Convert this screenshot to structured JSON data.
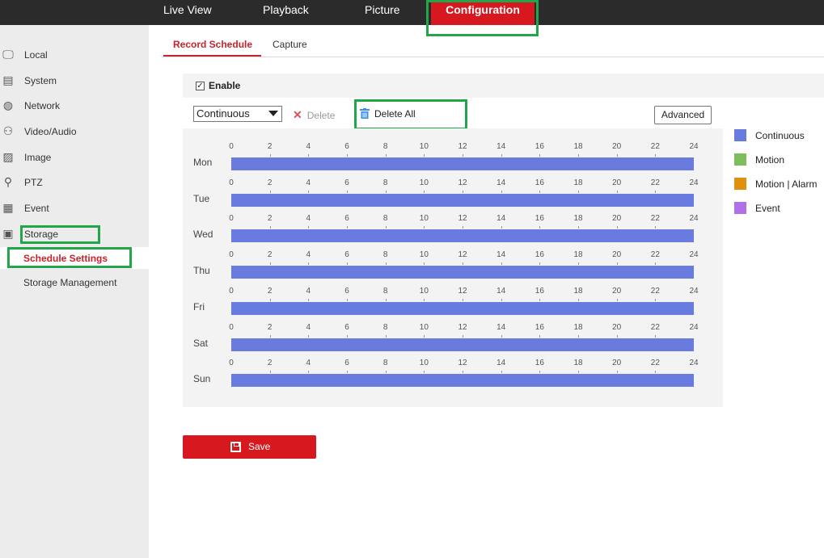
{
  "nav": {
    "items": [
      "Live View",
      "Playback",
      "Picture"
    ],
    "active": "Configuration"
  },
  "sidebar": {
    "items": [
      {
        "label": "Local",
        "icon": "monitor-icon"
      },
      {
        "label": "System",
        "icon": "system-icon"
      },
      {
        "label": "Network",
        "icon": "globe-icon"
      },
      {
        "label": "Video/Audio",
        "icon": "video-audio-icon"
      },
      {
        "label": "Image",
        "icon": "image-icon"
      },
      {
        "label": "PTZ",
        "icon": "ptz-icon"
      },
      {
        "label": "Event",
        "icon": "calendar-icon"
      },
      {
        "label": "Storage",
        "icon": "storage-icon"
      }
    ],
    "sub_items": [
      "Schedule Settings",
      "Storage Management"
    ]
  },
  "tabs": [
    "Record Schedule",
    "Capture"
  ],
  "enable": {
    "label": "Enable",
    "checked": true
  },
  "toolbar": {
    "record_type": "Continuous",
    "delete_label": "Delete",
    "delete_all_label": "Delete All",
    "advanced_label": "Advanced"
  },
  "schedule": {
    "hour_ticks": [
      "0",
      "2",
      "4",
      "6",
      "8",
      "10",
      "12",
      "14",
      "16",
      "18",
      "20",
      "22",
      "24"
    ],
    "days": [
      {
        "day": "Mon",
        "type": "Continuous",
        "start": 0,
        "end": 24
      },
      {
        "day": "Tue",
        "type": "Continuous",
        "start": 0,
        "end": 24
      },
      {
        "day": "Wed",
        "type": "Continuous",
        "start": 0,
        "end": 24
      },
      {
        "day": "Thu",
        "type": "Continuous",
        "start": 0,
        "end": 24
      },
      {
        "day": "Fri",
        "type": "Continuous",
        "start": 0,
        "end": 24
      },
      {
        "day": "Sat",
        "type": "Continuous",
        "start": 0,
        "end": 24
      },
      {
        "day": "Sun",
        "type": "Continuous",
        "start": 0,
        "end": 24
      }
    ]
  },
  "legend": [
    {
      "label": "Continuous",
      "color": "#6a7be0"
    },
    {
      "label": "Motion",
      "color": "#7dbd5a"
    },
    {
      "label": "Motion | Alarm",
      "color": "#e0900a"
    },
    {
      "label": "Event",
      "color": "#b070e8"
    }
  ],
  "save_label": "Save",
  "colors": {
    "accent": "#d7181f",
    "highlight": "#22a64a"
  }
}
